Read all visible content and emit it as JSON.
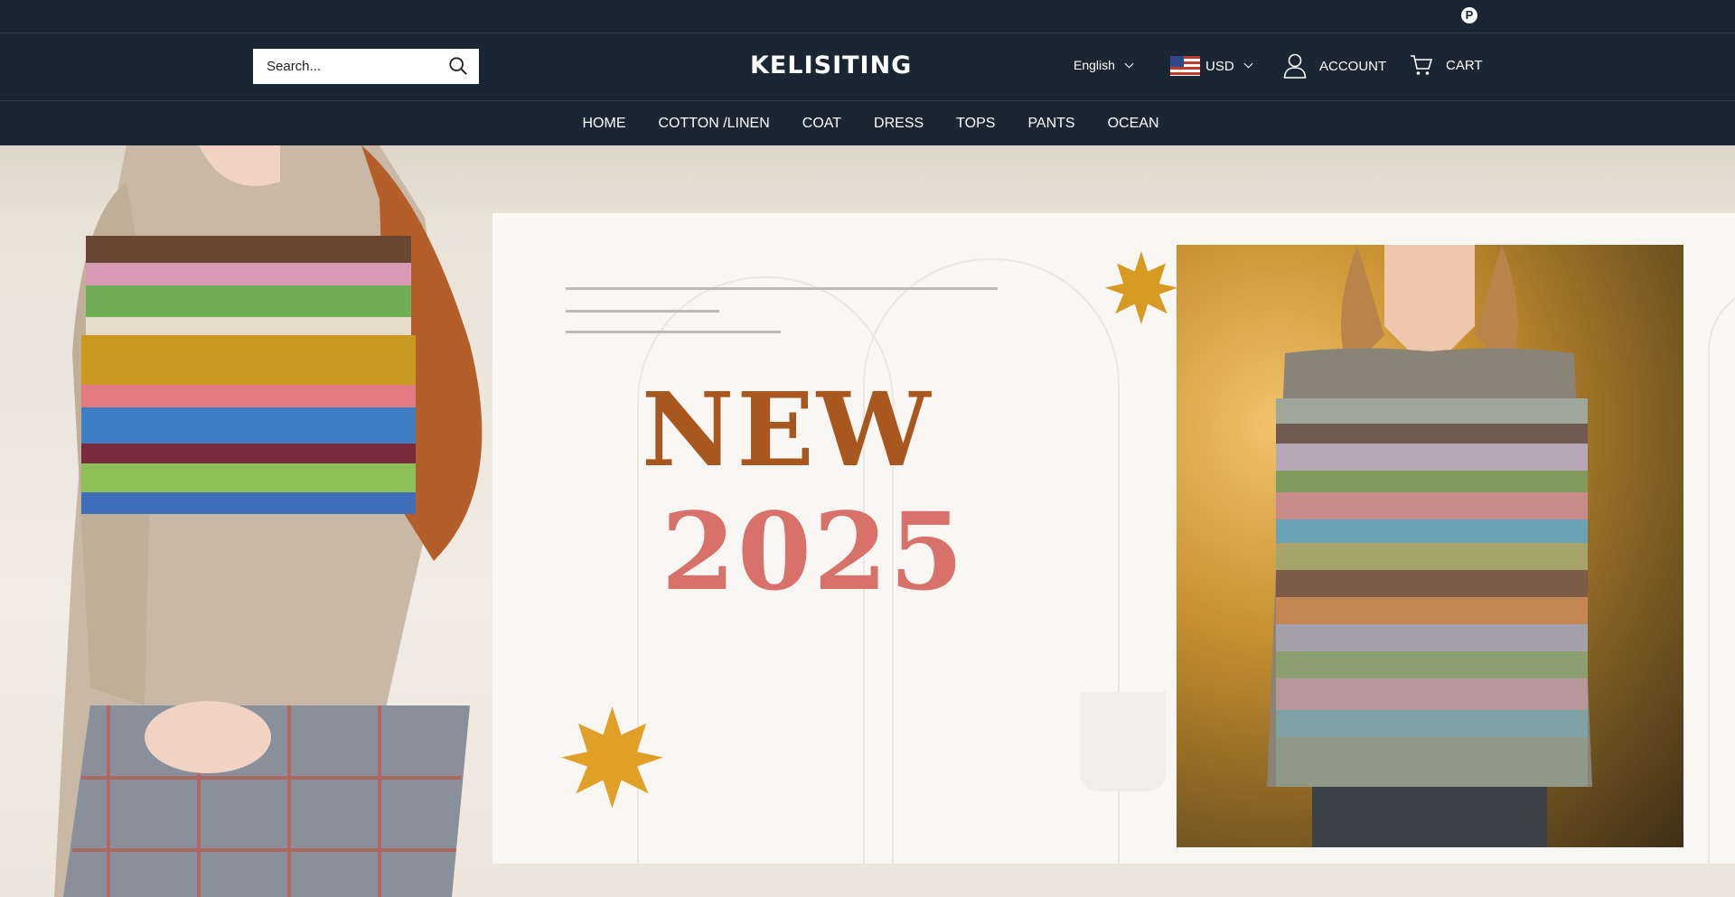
{
  "store": {
    "logo": "KELISITING"
  },
  "topbar": {
    "pinterest_icon": "pinterest-icon"
  },
  "header": {
    "search_placeholder": "Search...",
    "language": "English",
    "currency": "USD",
    "account_label": "ACCOUNT",
    "cart_label": "CART"
  },
  "nav": {
    "items": [
      "HOME",
      "COTTON /LINEN",
      "COAT",
      "DRESS",
      "TOPS",
      "PANTS",
      "OCEAN"
    ]
  },
  "hero": {
    "headline": "NEW",
    "year": "2025"
  },
  "colors": {
    "header_bg": "#1a2634",
    "headline": "#a8571e",
    "year": "#d8716a"
  }
}
